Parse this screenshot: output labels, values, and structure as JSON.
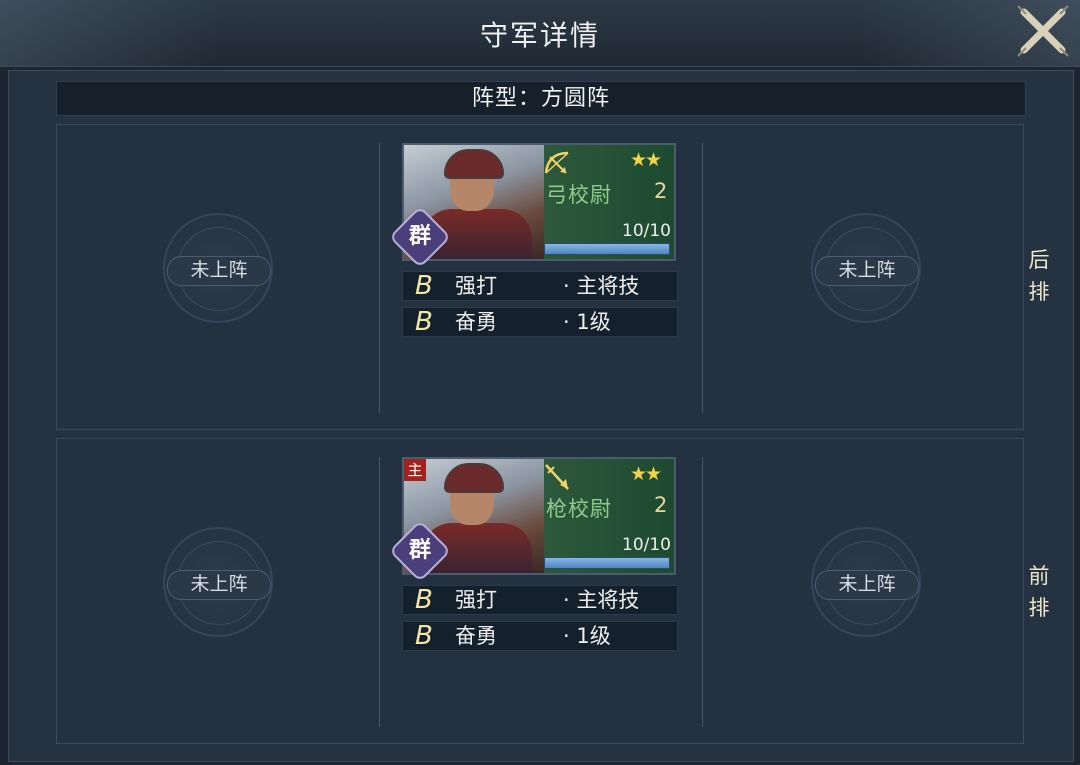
{
  "header": {
    "title": "守军详情"
  },
  "formation": {
    "label": "阵型：方圆阵"
  },
  "empty_slot_label": "未上阵",
  "rows": {
    "back": {
      "side_label_1": "后",
      "side_label_2": "排",
      "unit": {
        "faction": "群",
        "is_commander": false,
        "unit_type_icon": "bow-icon",
        "stars": "★★",
        "name": "弓校尉",
        "level": "2",
        "troops": "10/10",
        "troops_fraction": 1.0,
        "skills": [
          {
            "grade": "B",
            "name": "强打",
            "tag": "· 主将技"
          },
          {
            "grade": "B",
            "name": "奋勇",
            "tag": "· 1级"
          }
        ]
      }
    },
    "front": {
      "side_label_1": "前",
      "side_label_2": "排",
      "unit": {
        "commander_badge": "主",
        "faction": "群",
        "is_commander": true,
        "unit_type_icon": "spear-icon",
        "stars": "★★",
        "name": "枪校尉",
        "level": "2",
        "troops": "10/10",
        "troops_fraction": 1.0,
        "skills": [
          {
            "grade": "B",
            "name": "强打",
            "tag": "· 主将技"
          },
          {
            "grade": "B",
            "name": "奋勇",
            "tag": "· 1级"
          }
        ]
      }
    }
  },
  "colors": {
    "background": "#1d2630",
    "card_green": "#2f5a3d",
    "unit_name": "#8fcc8a",
    "stars": "#f3d24a",
    "faction_purple": "#4a3f7a",
    "commander_red": "#a2221d"
  }
}
